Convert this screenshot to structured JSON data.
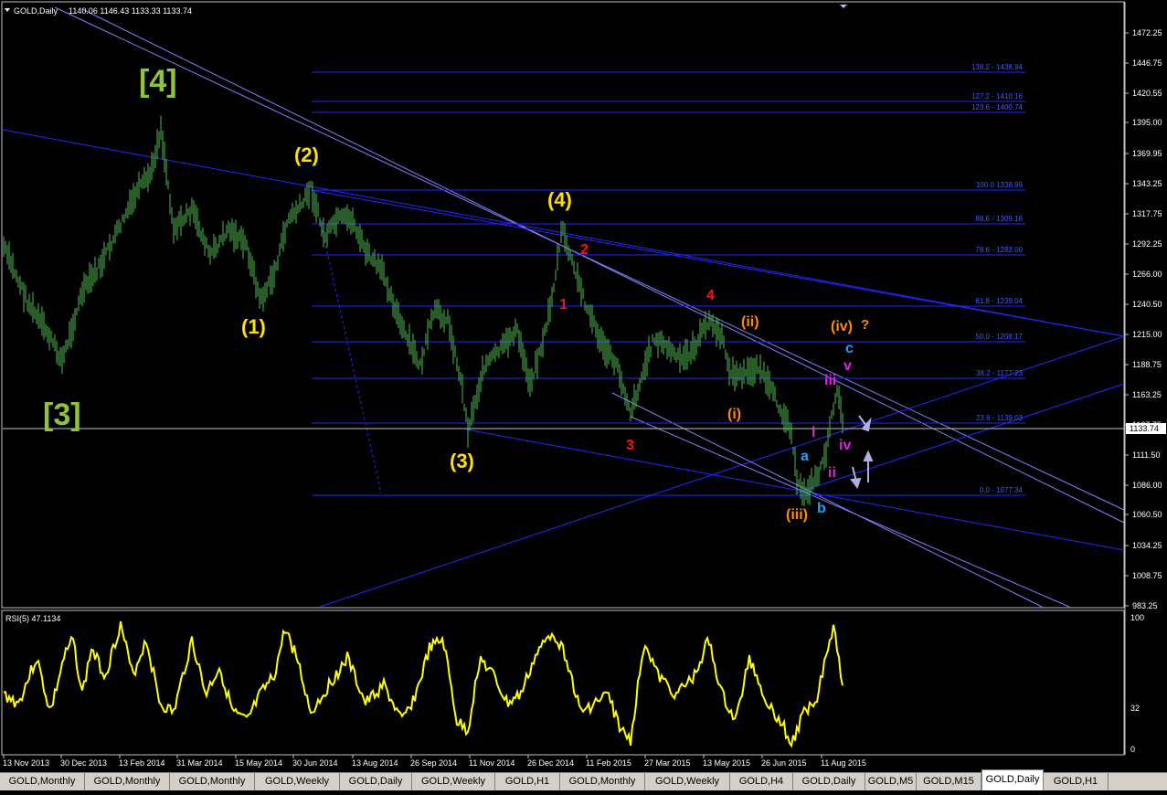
{
  "header": {
    "symbol": "GOLD,Daily",
    "ohlc": "1140.06 1146.43 1133.33 1133.74"
  },
  "price_axis": [
    "1472.25",
    "1446.75",
    "1420.55",
    "1395.00",
    "1369.95",
    "1343.25",
    "1317.75",
    "1292.25",
    "1266.00",
    "1240.50",
    "1215.00",
    "1188.75",
    "1163.25",
    "1137.75",
    "1111.50",
    "1086.00",
    "1060.50",
    "1034.25",
    "1008.75",
    "983.25"
  ],
  "current_price": "1133.74",
  "fib_levels": [
    {
      "label": "138.2 - 1438.94",
      "color": "#3f5cff"
    },
    {
      "label": "127.2 - 1410.16",
      "color": "#3f5cff"
    },
    {
      "label": "123.6 - 1400.74",
      "color": "#3f5cff"
    },
    {
      "label": "100.0 1338.99",
      "color": "#3f5cff"
    },
    {
      "label": "88.6 - 1309.16",
      "color": "#3f5cff"
    },
    {
      "label": "78.6 - 1283.00",
      "color": "#3f5cff"
    },
    {
      "label": "61.8 - 1239.04",
      "color": "#3f5cff"
    },
    {
      "label": "50.0 - 1208.17",
      "color": "#3f5cff"
    },
    {
      "label": "38.2 - 1177.23",
      "color": "#3f5cff"
    },
    {
      "label": "23.6 - 1139.03",
      "color": "#3f5cff"
    },
    {
      "label": "0.0 - 1077.34",
      "color": "#3f5cff"
    }
  ],
  "wave_labels": [
    {
      "text": "[4]",
      "color": "#8dc43c"
    },
    {
      "text": "[3]",
      "color": "#8dc43c"
    },
    {
      "text": "(2)",
      "color": "#ffe000"
    },
    {
      "text": "(1)",
      "color": "#ffe000"
    },
    {
      "text": "(4)",
      "color": "#ffe000"
    },
    {
      "text": "(3)",
      "color": "#ffe000"
    },
    {
      "text": "1",
      "color": "#ff1010"
    },
    {
      "text": "2",
      "color": "#ff1010"
    },
    {
      "text": "3",
      "color": "#ff1010"
    },
    {
      "text": "4",
      "color": "#ff1010"
    },
    {
      "text": "(ii)",
      "color": "#ff8c00"
    },
    {
      "text": "(i)",
      "color": "#ff8c00"
    },
    {
      "text": "(iii)",
      "color": "#ff8c00"
    },
    {
      "text": "(iv)",
      "color": "#ff8c00"
    },
    {
      "text": "?",
      "color": "#ff8c00"
    },
    {
      "text": "c",
      "color": "#1ea0ff"
    },
    {
      "text": "a",
      "color": "#1ea0ff"
    },
    {
      "text": "b",
      "color": "#1ea0ff"
    },
    {
      "text": "v",
      "color": "#e020e0"
    },
    {
      "text": "iii",
      "color": "#e020e0"
    },
    {
      "text": "i",
      "color": "#e020e0"
    },
    {
      "text": "iv",
      "color": "#e020e0"
    },
    {
      "text": "ii",
      "color": "#e020e0"
    }
  ],
  "rsi": {
    "label": "RSI(5) 47.1134",
    "axis": [
      "100",
      "32",
      "0"
    ]
  },
  "dates": [
    "13 Nov 2013",
    "30 Dec 2013",
    "13 Feb 2014",
    "31 Mar 2014",
    "15 May 2014",
    "30 Jun 2014",
    "13 Aug 2014",
    "26 Sep 2014",
    "11 Nov 2014",
    "26 Dec 2014",
    "11 Feb 2015",
    "27 Mar 2015",
    "13 May 2015",
    "26 Jun 2015",
    "11 Aug 2015"
  ],
  "tabs": [
    "GOLD,Monthly",
    "GOLD,Monthly",
    "GOLD,Monthly",
    "GOLD,Weekly",
    "GOLD,Daily",
    "GOLD,Weekly",
    "GOLD,H1",
    "GOLD,Monthly",
    "GOLD,Weekly",
    "GOLD,H4",
    "GOLD,Daily",
    "GOLD,M5",
    "GOLD,M15",
    "GOLD,Daily",
    "GOLD,H1"
  ],
  "active_tab": "GOLD,Daily",
  "colors": {
    "candles": "#4fb84f",
    "rsi": "#ffff00",
    "lines": "#2626ff",
    "grid_text": "#ffffff"
  }
}
